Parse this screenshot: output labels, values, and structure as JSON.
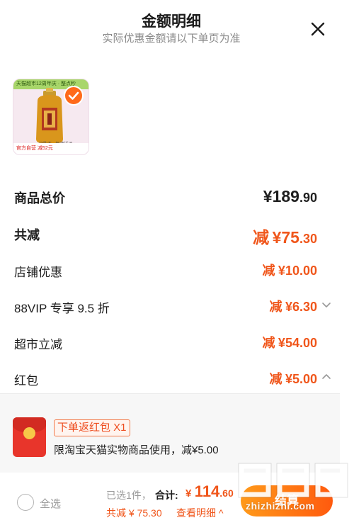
{
  "header": {
    "title": "金额明细",
    "subtitle": "实际优惠金额请以下单页为准"
  },
  "product": {
    "thumb_top_text": "天猫超市12周年庆 · 整点秒",
    "thumb_mid_text": "一站购齐 · 极速送达",
    "thumb_bottom_text": "官方自营 减52元",
    "selected": true
  },
  "summary": {
    "total_label": "商品总价",
    "total_currency": "¥",
    "total_int": "189",
    "total_dec": ".90",
    "reduce_label": "共减",
    "reduce_prefix": "减",
    "reduce_currency": "¥",
    "reduce_int": "75",
    "reduce_dec": ".30"
  },
  "discounts": [
    {
      "label": "店铺优惠",
      "prefix": "减",
      "currency": "¥",
      "int": "10",
      "dec": ".00",
      "chevron": "none"
    },
    {
      "label": "88VIP 专享 9.5 折",
      "prefix": "减",
      "currency": "¥",
      "int": "6",
      "dec": ".30",
      "chevron": "down"
    },
    {
      "label": "超市立减",
      "prefix": "减",
      "currency": "¥",
      "int": "54",
      "dec": ".00",
      "chevron": "none"
    },
    {
      "label": "红包",
      "prefix": "减",
      "currency": "¥",
      "int": "5",
      "dec": ".00",
      "chevron": "up"
    }
  ],
  "coupon": {
    "tag": "下单返红包 X1",
    "description": "限淘宝天猫实物商品使用，减¥5.00"
  },
  "footer": {
    "select_all": "全选",
    "selected_count": "已选1件，",
    "total_label": "合计:",
    "total_currency": "¥",
    "total_int": "114",
    "total_dec": ".60",
    "discount_text": "共减 ¥ 75.30",
    "view_detail": "查看明细 ^",
    "checkout": "结算"
  },
  "watermark": {
    "text": "zhizhizhi.com"
  },
  "colors": {
    "accent": "#f0561b",
    "checkout_start": "#ff9a1a",
    "checkout_end": "#ff5a0e",
    "coupon_panel_bg": "#f7f7f7",
    "red_packet": "#e8352b"
  },
  "icons": {
    "close": "close-icon",
    "check": "check-icon",
    "chevron_down": "chevron-down-icon",
    "chevron_up": "chevron-up-icon",
    "red_packet": "red-packet-icon"
  }
}
